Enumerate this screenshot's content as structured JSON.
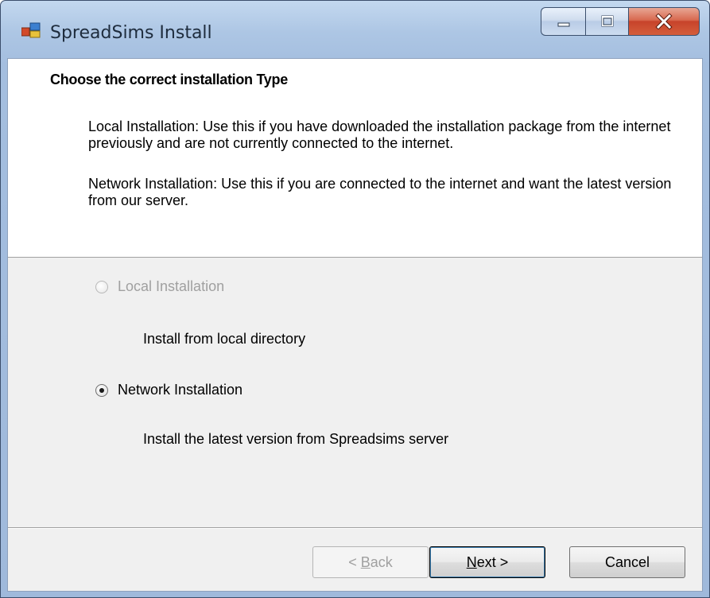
{
  "window": {
    "title": "SpreadSims Install"
  },
  "header": {
    "title": "Choose the correct installation Type",
    "local_desc": "Local Installation: Use this if you have downloaded the installation package from the internet previously and are not currently connected to the internet.",
    "network_desc": "Network Installation: Use this if you are connected to the internet and want the latest version from our server."
  },
  "options": {
    "local": {
      "label": "Local Installation",
      "description": "Install from local directory",
      "enabled": false,
      "selected": false
    },
    "network": {
      "label": "Network Installation",
      "description": "Install the latest version from Spreadsims server",
      "enabled": true,
      "selected": true
    }
  },
  "buttons": {
    "back_prefix": "< ",
    "back_mnemonic": "B",
    "back_rest": "ack",
    "next_mnemonic": "N",
    "next_rest": "ext >",
    "cancel": "Cancel"
  },
  "colors": {
    "title_bar": "#adc6e4",
    "close_button": "#c7432a",
    "disabled_text": "#a0a0a0"
  }
}
